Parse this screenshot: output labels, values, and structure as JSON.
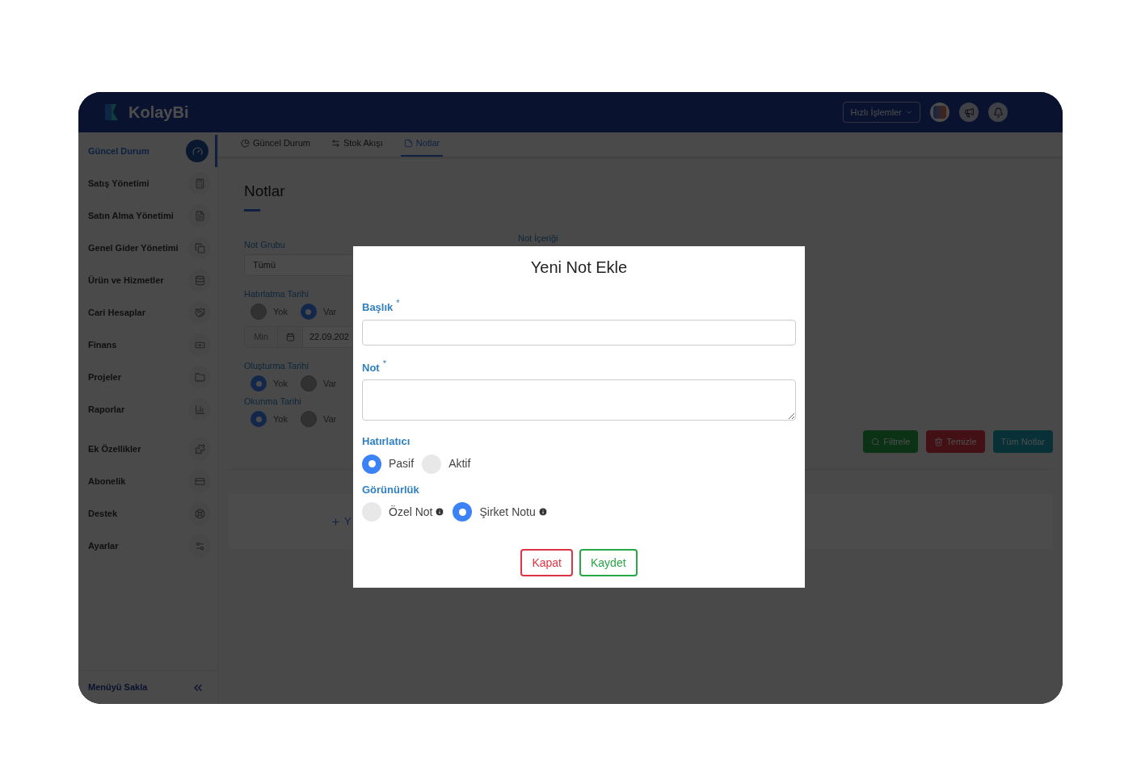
{
  "header": {
    "logo": "KolayBi",
    "quick_actions": "Hızlı İşlemler"
  },
  "sidebar": {
    "items": [
      {
        "label": "Güncel Durum",
        "selected": true
      },
      {
        "label": "Satış Yönetimi",
        "selected": false
      },
      {
        "label": "Satın Alma Yönetimi",
        "selected": false
      },
      {
        "label": "Genel Gider Yönetimi",
        "selected": false
      },
      {
        "label": "Ürün ve Hizmetler",
        "selected": false
      },
      {
        "label": "Cari Hesaplar",
        "selected": false
      },
      {
        "label": "Finans",
        "selected": false
      },
      {
        "label": "Projeler",
        "selected": false
      },
      {
        "label": "Raporlar",
        "selected": false
      },
      {
        "label": "Ek Özellikler",
        "selected": false
      },
      {
        "label": "Abonelik",
        "selected": false
      },
      {
        "label": "Destek",
        "selected": false
      },
      {
        "label": "Ayarlar",
        "selected": false
      }
    ],
    "hide_menu": "Menüyü Sakla"
  },
  "tabs": [
    {
      "label": "Güncel Durum",
      "selected": false
    },
    {
      "label": "Stok Akışı",
      "selected": false
    },
    {
      "label": "Notlar",
      "selected": true
    }
  ],
  "page": {
    "title": "Notlar",
    "note_group": {
      "label": "Not Grubu",
      "value": "Tümü"
    },
    "note_content": {
      "label": "Not İçeriği"
    },
    "reminder_date": {
      "label": "Hatırlatma Tarihi",
      "options": [
        {
          "label": "Yok",
          "selected": false
        },
        {
          "label": "Var",
          "selected": true
        }
      ],
      "addon": "Min",
      "value": "22.09.202"
    },
    "created_date": {
      "label": "Oluşturma Tarihi",
      "options": [
        {
          "label": "Yok",
          "selected": true
        },
        {
          "label": "Var",
          "selected": false
        }
      ]
    },
    "read_date": {
      "label": "Okunma Tarihi",
      "options": [
        {
          "label": "Yok",
          "selected": true
        },
        {
          "label": "Var",
          "selected": false
        }
      ]
    },
    "buttons": [
      {
        "label": "Filtrele",
        "kind": "filter"
      },
      {
        "label": "Temizle",
        "kind": "clear"
      },
      {
        "label": "Tüm Notlar",
        "kind": "all"
      }
    ],
    "add_button": "Y"
  },
  "modal": {
    "title": "Yeni Not Ekle",
    "fields": [
      {
        "label": "Başlık",
        "marker": "*",
        "kind": "input"
      },
      {
        "label": "Not",
        "marker": "*",
        "kind": "textarea"
      }
    ],
    "groups": [
      {
        "label": "Hatırlatıcı",
        "options": [
          {
            "label": "Pasif",
            "selected": true,
            "info": false
          },
          {
            "label": "Aktif",
            "selected": false,
            "info": false
          }
        ]
      },
      {
        "label": "Görünürlük",
        "options": [
          {
            "label": "Özel Not",
            "selected": false,
            "info": true
          },
          {
            "label": "Şirket Notu",
            "selected": true,
            "info": true
          }
        ]
      }
    ],
    "buttons": [
      {
        "label": "Kapat",
        "kind": "danger"
      },
      {
        "label": "Kaydet",
        "kind": "success"
      }
    ]
  }
}
